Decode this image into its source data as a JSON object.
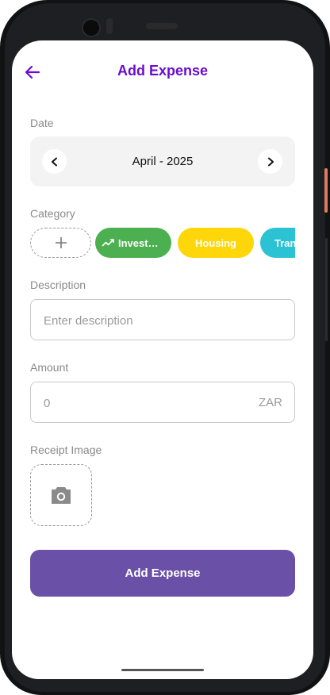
{
  "header": {
    "title": "Add Expense"
  },
  "date": {
    "label": "Date",
    "value": "April - 2025"
  },
  "category": {
    "label": "Category",
    "chips": [
      {
        "label": "Investm...",
        "color": "#4caf50",
        "icon": "trend-up-icon"
      },
      {
        "label": "Housing",
        "color": "#ffd60a"
      },
      {
        "label": "Tran",
        "color": "#2bc3d3"
      }
    ]
  },
  "description": {
    "label": "Description",
    "placeholder": "Enter description"
  },
  "amount": {
    "label": "Amount",
    "placeholder": "0",
    "currency": "ZAR"
  },
  "receipt": {
    "label": "Receipt Image",
    "icon": "camera-icon"
  },
  "submit": {
    "label": "Add Expense",
    "color": "#6a50a7"
  },
  "colors": {
    "accent": "#6a0dcf"
  }
}
